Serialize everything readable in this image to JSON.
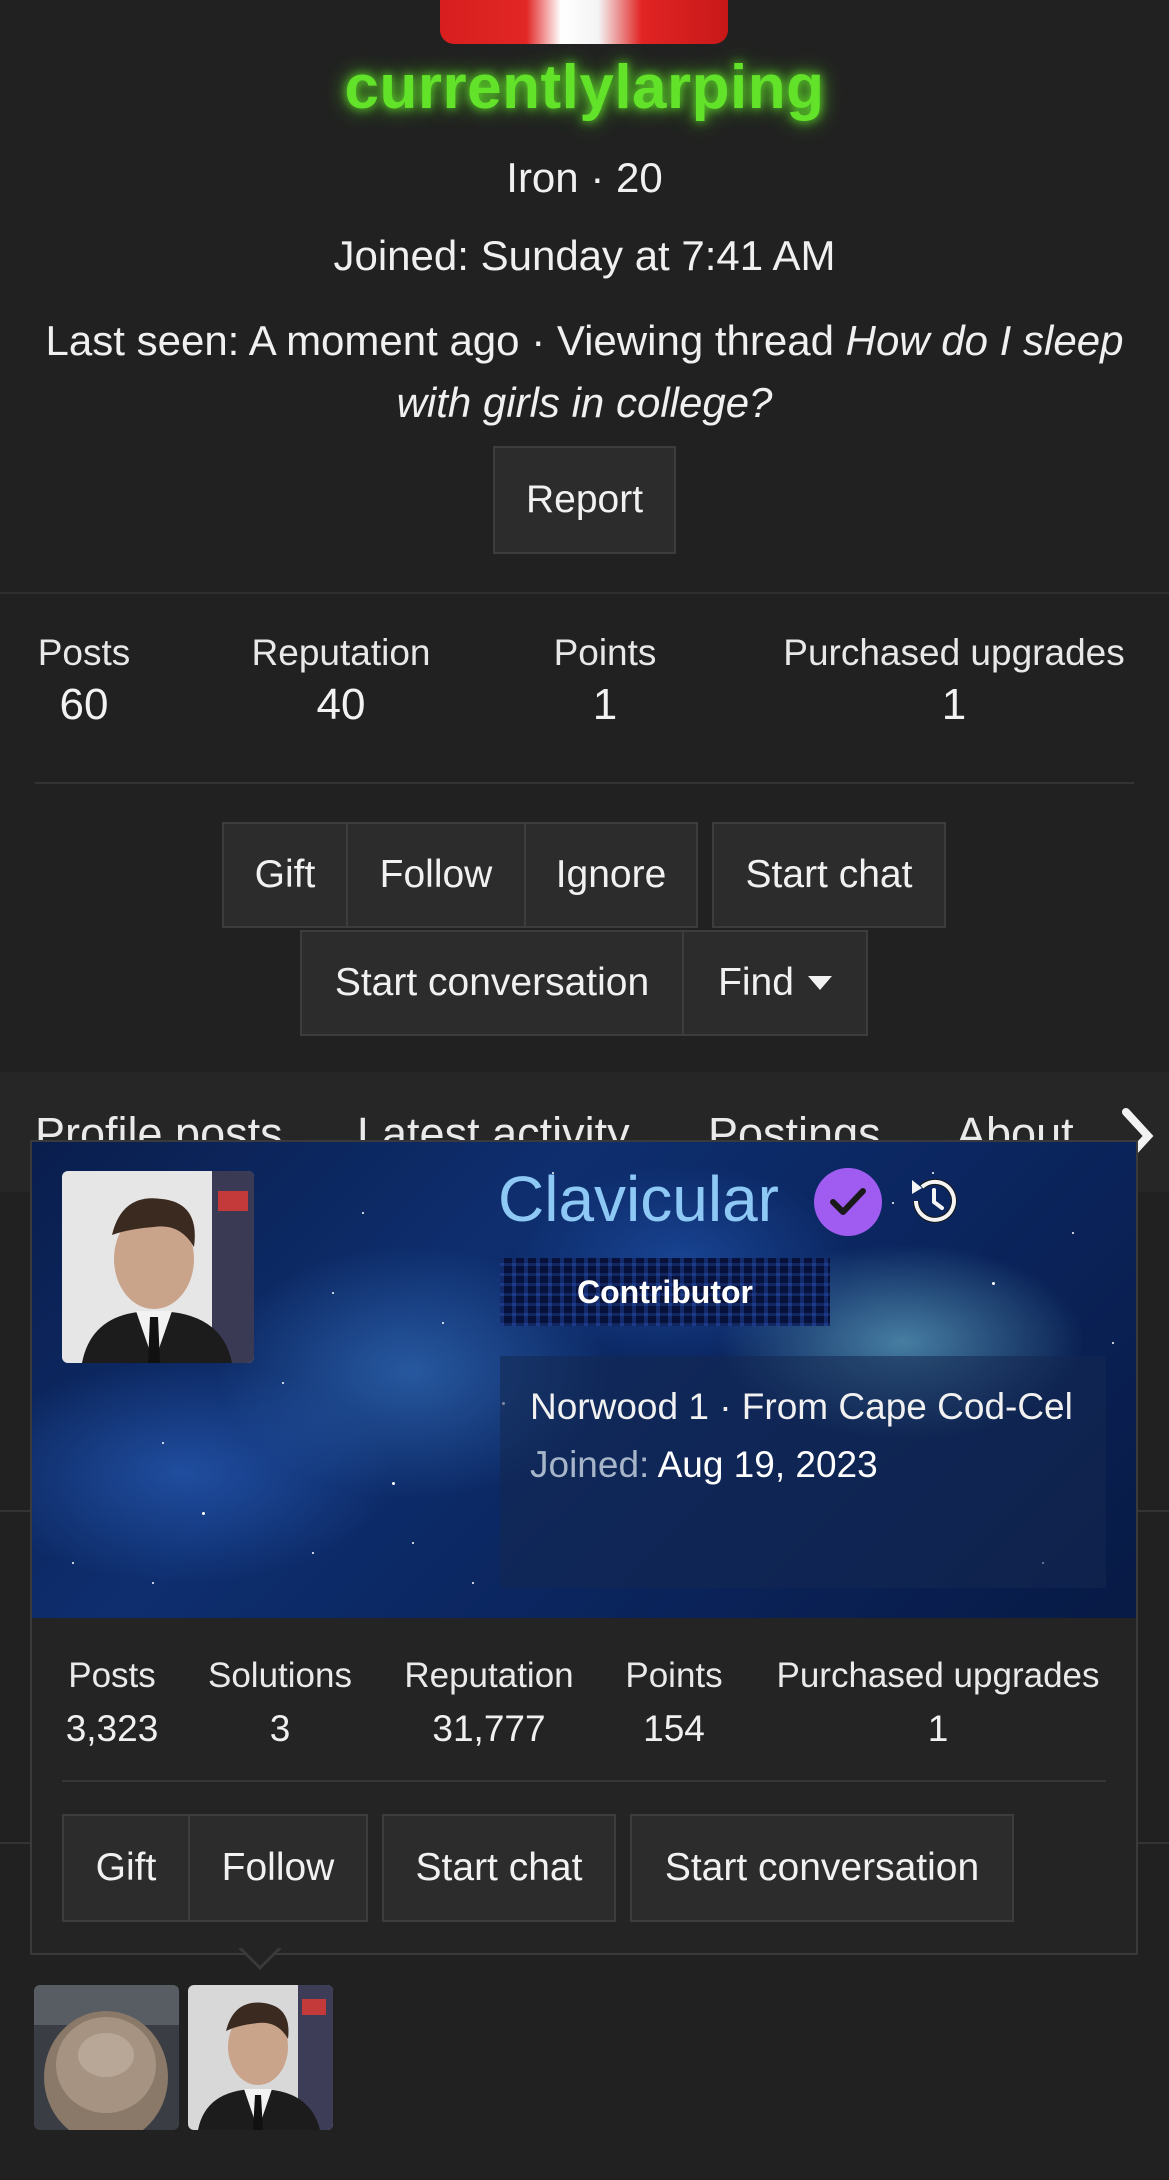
{
  "profile": {
    "username": "currentlylarping",
    "rank_line": "Iron · 20",
    "joined_line": "Joined: Sunday at 7:41 AM",
    "last_seen_prefix": "Last seen: A moment ago · Viewing thread ",
    "last_seen_thread": "How do I sleep with girls in college?",
    "report_label": "Report",
    "name_color": "#62e32a"
  },
  "stats": [
    {
      "label": "Posts",
      "value": "60"
    },
    {
      "label": "Reputation",
      "value": "40"
    },
    {
      "label": "Points",
      "value": "1"
    },
    {
      "label": "Purchased upgrades",
      "value": "1"
    }
  ],
  "actions": {
    "gift": "Gift",
    "follow": "Follow",
    "ignore": "Ignore",
    "start_chat": "Start chat",
    "start_conversation": "Start conversation",
    "find": "Find"
  },
  "tabs": [
    "Profile posts",
    "Latest activity",
    "Postings",
    "About"
  ],
  "member_card": {
    "name": "Clavicular",
    "name_color": "#8ec8f5",
    "verified_color": "#a05cf0",
    "badge": "Contributor",
    "info_line": "Norwood 1 · From Cape Cod-Cel",
    "joined_label": "Joined:",
    "joined_value": "Aug 19, 2023",
    "stats": [
      {
        "label": "Posts",
        "value": "3,323"
      },
      {
        "label": "Solutions",
        "value": "3"
      },
      {
        "label": "Reputation",
        "value": "31,777"
      },
      {
        "label": "Points",
        "value": "154"
      },
      {
        "label": "Purchased upgrades",
        "value": "1"
      }
    ],
    "actions": {
      "gift": "Gift",
      "follow": "Follow",
      "start_chat": "Start chat",
      "start_conversation": "Start conversation"
    }
  },
  "icons": {
    "verified": "check-badge-icon",
    "history": "history-icon",
    "find_caret": "caret-down-icon",
    "tab_scroll": "chevron-right-icon"
  }
}
